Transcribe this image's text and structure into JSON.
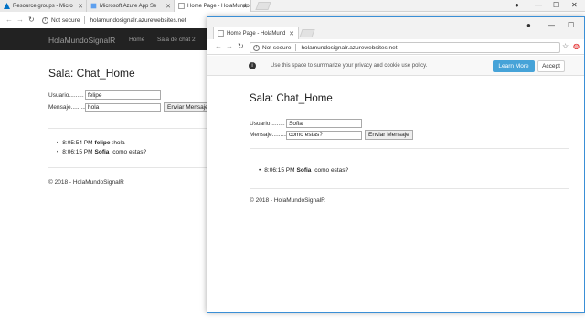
{
  "bg_browser": {
    "tabs": [
      {
        "label": "Resource groups - Micro",
        "icon": "azure-icon"
      },
      {
        "label": "Microsoft Azure App Se",
        "icon": "app-service-icon"
      },
      {
        "label": "Home Page - HolaMundo",
        "icon": "page-icon"
      }
    ],
    "security": "Not secure",
    "url": "holamundosignalr.azurewebsites.net"
  },
  "bg_page": {
    "brand": "HolaMundoSignalR",
    "nav": [
      "Home",
      "Sala de chat 2"
    ],
    "title": "Sala: Chat_Home",
    "usuario_label": "Usuario.........",
    "usuario_value": "felipe",
    "mensaje_label": "Mensaje.........",
    "mensaje_value": "hola",
    "send_label": "Enviar Mensaje",
    "messages": [
      {
        "time": "8:05:54 PM",
        "user": "felipe",
        "text": ":hola"
      },
      {
        "time": "8:06:15 PM",
        "user": "Sofia",
        "text": ":como estas?"
      }
    ],
    "footer": "© 2018 - HolaMundoSignalR"
  },
  "fg_browser": {
    "tab_label": "Home Page - HolaMund",
    "security": "Not secure",
    "url": "holamundosignalr.azurewebsites.net"
  },
  "fg_page": {
    "cookie_text": "Use this space to summarize your privacy and cookie use policy.",
    "learn_more": "Learn More",
    "accept": "Accept",
    "title": "Sala: Chat_Home",
    "usuario_label": "Usuario.........",
    "usuario_value": "Sofia",
    "mensaje_label": "Mensaje.........",
    "mensaje_value": "como estas?",
    "send_label": "Enviar Mensaje",
    "messages": [
      {
        "time": "8:06:15 PM",
        "user": "Sofia",
        "text": ":como estas?"
      }
    ],
    "footer": "© 2018 - HolaMundoSignalR"
  },
  "colors": {
    "navbar": "#222222",
    "accent": "#46a3d8",
    "window_border": "#3a8fd6"
  }
}
